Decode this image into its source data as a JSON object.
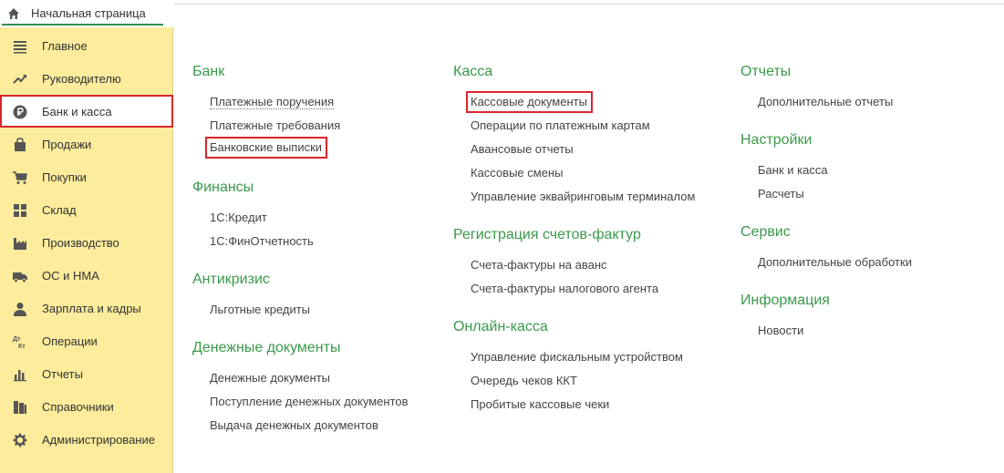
{
  "home_tab": {
    "label": "Начальная страница",
    "icon": "home-icon"
  },
  "sidebar": {
    "items": [
      {
        "label": "Главное",
        "icon": "menu-lines-icon"
      },
      {
        "label": "Руководителю",
        "icon": "trend-up-icon"
      },
      {
        "label": "Банк и касса",
        "icon": "ruble-coin-icon"
      },
      {
        "label": "Продажи",
        "icon": "shopping-bag-icon"
      },
      {
        "label": "Покупки",
        "icon": "shopping-cart-icon"
      },
      {
        "label": "Склад",
        "icon": "warehouse-grid-icon"
      },
      {
        "label": "Производство",
        "icon": "factory-icon"
      },
      {
        "label": "ОС и НМА",
        "icon": "truck-icon"
      },
      {
        "label": "Зарплата и кадры",
        "icon": "person-icon"
      },
      {
        "label": "Операции",
        "icon": "debit-credit-icon"
      },
      {
        "label": "Отчеты",
        "icon": "bar-chart-icon"
      },
      {
        "label": "Справочники",
        "icon": "books-icon"
      },
      {
        "label": "Администрирование",
        "icon": "gear-icon"
      }
    ]
  },
  "columns": {
    "col1": {
      "bank": {
        "title": "Банк",
        "links": [
          "Платежные поручения",
          "Платежные требования",
          "Банковские выписки"
        ]
      },
      "finance": {
        "title": "Финансы",
        "links": [
          "1С:Кредит",
          "1С:ФинОтчетность"
        ]
      },
      "anticrisis": {
        "title": "Антикризис",
        "links": [
          "Льготные кредиты"
        ]
      },
      "money_docs": {
        "title": "Денежные документы",
        "links": [
          "Денежные документы",
          "Поступление денежных документов",
          "Выдача денежных документов"
        ]
      }
    },
    "col2": {
      "kassa": {
        "title": "Касса",
        "links": [
          "Кассовые документы",
          "Операции по платежным картам",
          "Авансовые отчеты",
          "Кассовые смены",
          "Управление эквайринговым терминалом"
        ]
      },
      "invoices": {
        "title": "Регистрация счетов-фактур",
        "links": [
          "Счета-фактуры на аванс",
          "Счета-фактуры налогового агента"
        ]
      },
      "online_kassa": {
        "title": "Онлайн-касса",
        "links": [
          "Управление фискальным устройством",
          "Очередь чеков ККТ",
          "Пробитые кассовые чеки"
        ]
      }
    },
    "col3": {
      "reports": {
        "title": "Отчеты",
        "links": [
          "Дополнительные отчеты"
        ]
      },
      "settings": {
        "title": "Настройки",
        "links": [
          "Банк и касса",
          "Расчеты"
        ]
      },
      "service": {
        "title": "Сервис",
        "links": [
          "Дополнительные обработки"
        ]
      },
      "info": {
        "title": "Информация",
        "links": [
          "Новости"
        ]
      }
    }
  },
  "colors": {
    "sidebar_bg": "#fcec9c",
    "section_title": "#3a9a4a",
    "highlight": "#d9262c",
    "tab_underline": "#2f8f4f"
  }
}
